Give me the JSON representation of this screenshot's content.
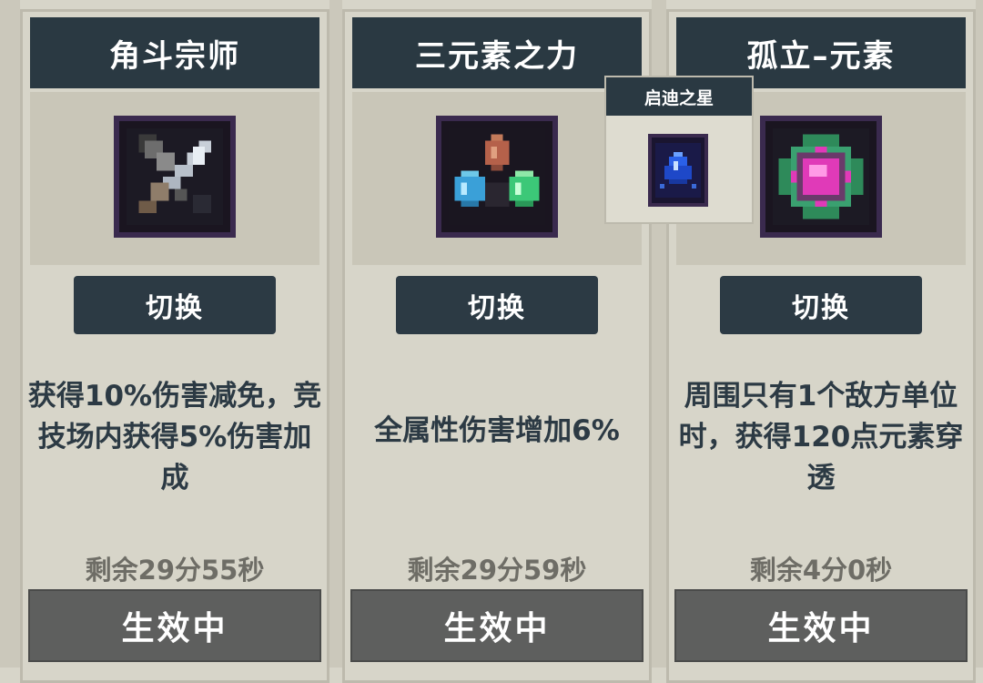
{
  "cards": [
    {
      "title": "角斗宗师",
      "icon": "sword-icon",
      "switch_label": "切换",
      "description": "获得10%伤害减免，竞技场内获得5%伤害加成",
      "remaining": "剩余29分55秒",
      "status": "生效中"
    },
    {
      "title": "三元素之力",
      "icon": "three-crystals-icon",
      "switch_label": "切换",
      "description": "全属性伤害增加6%",
      "remaining": "剩余29分59秒",
      "status": "生效中"
    },
    {
      "title": "孤立–元素",
      "icon": "element-orb-icon",
      "switch_label": "切换",
      "description": "周围只有1个敌方单位时，获得120点元素穿透",
      "remaining": "剩余4分0秒",
      "status": "生效中"
    }
  ],
  "tooltip": {
    "title": "启迪之星",
    "icon": "blue-star-crystal-icon"
  },
  "colors": {
    "title_bar": "#2a3942",
    "background": "#d7d5c9",
    "status_button": "#5e5f5e",
    "text_dark": "#2c3a44",
    "text_muted": "#6e6d66"
  }
}
